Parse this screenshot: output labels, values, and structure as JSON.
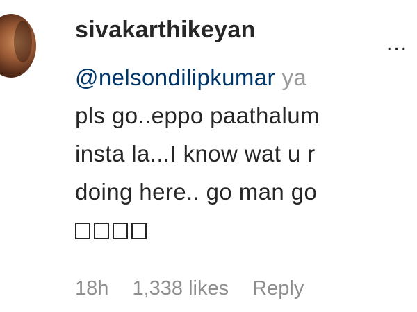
{
  "comment": {
    "username": "sivakarthikeyan",
    "mention": "@nelsondilipkumar",
    "mention_tail": "ya",
    "lines": [
      "pls go..eppo paathalum",
      "insta la...I know wat u r",
      "doing here.. go man go"
    ],
    "emoji_count": 4,
    "more_label": "..."
  },
  "meta": {
    "time": "18h",
    "likes": "1,338 likes",
    "reply": "Reply"
  },
  "colors": {
    "text": "#262626",
    "mention": "#00376b",
    "muted": "#8e8e8e"
  }
}
